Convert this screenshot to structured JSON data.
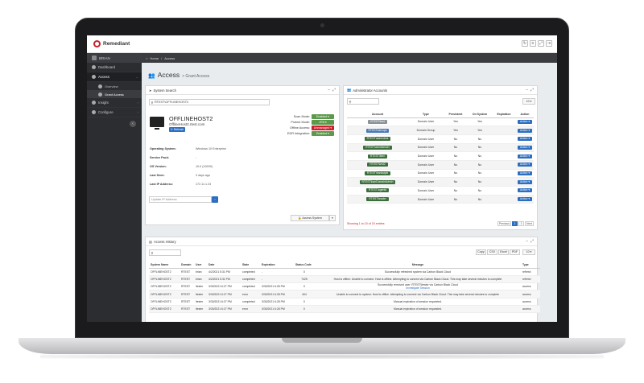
{
  "app": {
    "brand": "Remediant"
  },
  "colors": {
    "accent": "#2d6ec0",
    "danger": "#c8202c",
    "success": "#5b9a4a",
    "sidebar": "#2b2d31",
    "badge_dark": "#3c6e3c",
    "badge_grey": "#8a9399",
    "badge_blue": "#4a7ab5"
  },
  "topbar": {
    "icons": [
      "refresh-icon",
      "list-icon",
      "expand-icon",
      "logout-icon"
    ]
  },
  "sidebar": {
    "user": "BRIAN",
    "items": [
      {
        "label": "Dashboard"
      },
      {
        "label": "Access"
      },
      {
        "label": "Overview"
      },
      {
        "label": "Grant Access"
      },
      {
        "label": "Insight"
      },
      {
        "label": "Configure"
      }
    ]
  },
  "breadcrumb": {
    "home": "Home",
    "sep": "/",
    "current": "Access"
  },
  "page": {
    "title": "Access",
    "subtitle": "> Grant Access"
  },
  "system_search": {
    "title": "System Search",
    "search_value": "RTEST\\OFFLINEHOST2",
    "host_name": "OFFLINEHOST2",
    "host_fqdn": "OfflineHost2.rtest.com",
    "refresh_label": "Refresh",
    "modes": [
      {
        "label": "Scan Mode:",
        "value": "Enabled"
      },
      {
        "label": "Protect Mode:",
        "value": "JITA"
      },
      {
        "label": "Offline Access:",
        "value": "Unmanaged"
      },
      {
        "label": "EDR Integration:",
        "value": "Enabled"
      }
    ],
    "details": [
      {
        "label": "Operating System:",
        "value": "Windows 10 Enterprise"
      },
      {
        "label": "Service Pack:",
        "value": "-"
      },
      {
        "label": "OS Version:",
        "value": "10.0 (19209)"
      },
      {
        "label": "Last Seen:",
        "value": "3 days ago"
      },
      {
        "label": "Last IP Address:",
        "value": "172.11.1.23"
      }
    ],
    "ip_placeholder": "Update IP Address",
    "access_button": "Access System"
  },
  "admin_accounts": {
    "title": "Administrator Accounts",
    "page_size": "10",
    "headers": [
      "Account",
      "Type",
      "Persistent",
      "On System",
      "Expiration",
      "Action"
    ],
    "rows": [
      {
        "account": "RTEST\\test",
        "type": "Domain User",
        "persistent": "Yes",
        "on_system": "Yes",
        "expiration": "",
        "action": "Action",
        "badge": "grey"
      },
      {
        "account": "RTEST\\devops",
        "type": "Domain Group",
        "persistent": "Yes",
        "on_system": "Yes",
        "expiration": "",
        "action": "Action",
        "badge": "blue"
      },
      {
        "account": "RTEST\\admintest",
        "type": "Domain User",
        "persistent": "No",
        "on_system": "No",
        "expiration": "",
        "action": "Action",
        "badge": "dark"
      },
      {
        "account": "RTEST\\admintester",
        "type": "Domain User",
        "persistent": "No",
        "on_system": "No",
        "expiration": "",
        "action": "Action",
        "badge": "dark"
      },
      {
        "account": "RTEST\\bien",
        "type": "Domain User",
        "persistent": "No",
        "on_system": "No",
        "expiration": "",
        "action": "Action",
        "badge": "dark"
      },
      {
        "account": "RTEST\\test2",
        "type": "Domain User",
        "persistent": "No",
        "on_system": "No",
        "expiration": "",
        "action": "Action",
        "badge": "dark"
      },
      {
        "account": "RTEST\\frankstyle",
        "type": "Domain User",
        "persistent": "No",
        "on_system": "No",
        "expiration": "",
        "action": "Action",
        "badge": "dark"
      },
      {
        "account": "RTEST\\hanDomainAdmin",
        "type": "Domain User",
        "persistent": "No",
        "on_system": "No",
        "expiration": "",
        "action": "Action",
        "badge": "dark"
      },
      {
        "account": "RTEST\\agentd",
        "type": "Domain User",
        "persistent": "No",
        "on_system": "No",
        "expiration": "",
        "action": "Action",
        "badge": "dark"
      },
      {
        "account": "RTEST\\leader",
        "type": "Domain User",
        "persistent": "No",
        "on_system": "No",
        "expiration": "",
        "action": "Action",
        "badge": "dark"
      }
    ],
    "showing": "Showing 1 to 10 of 15 entries",
    "pagination": [
      "Previous",
      "1",
      "2",
      "Next"
    ]
  },
  "access_history": {
    "title": "Access History",
    "tools": [
      "Copy",
      "CSV",
      "Excel",
      "PDF"
    ],
    "page_size": "10",
    "headers": [
      "System Name",
      "Domain",
      "User",
      "Date",
      "State",
      "Expiration",
      "Status Code",
      "Message",
      "Type"
    ],
    "rows": [
      {
        "system": "OFFLINEHOST2",
        "domain": "RTEST",
        "user": "brian",
        "date": "4/2/2021 5:31 PM",
        "state": "completed",
        "expiration": "-",
        "code": "0",
        "message": "Successfully refreshed system via Carbon Black Cloud",
        "link": "",
        "type": "refresh"
      },
      {
        "system": "OFFLINEHOST2",
        "domain": "RTEST",
        "user": "brian",
        "date": "4/2/2021 5:31 PM",
        "state": "completed",
        "expiration": "-",
        "code": "7425",
        "message": "Host is offline: Unable to connect. Host is offline. Attempting to connect via Carbon Black Cloud. This may take several minutes to complete",
        "link": "",
        "type": "refresh"
      },
      {
        "system": "OFFLINEHOST2",
        "domain": "RTEST",
        "user": "ltester",
        "date": "3/30/2021 6:27 PM",
        "state": "completed",
        "expiration": "3/30/2021 6:28 PM",
        "code": "0",
        "message": "Successfully removed user: RTEST\\ltester via Carbon Black Cloud",
        "link": "Investigate Session",
        "type": "access"
      },
      {
        "system": "OFFLINEHOST2",
        "domain": "RTEST",
        "user": "ltester",
        "date": "3/30/2021 6:27 PM",
        "state": "error",
        "expiration": "3/30/2021 6:28 PM",
        "code": "404",
        "message": "Unable to connect to system: Host is offline. Attempting to connect via Carbon Black Cloud. This may take several minutes to complete",
        "link": "",
        "type": "access"
      },
      {
        "system": "OFFLINEHOST2",
        "domain": "RTEST",
        "user": "ltester",
        "date": "3/30/2021 6:27 PM",
        "state": "completed",
        "expiration": "3/30/2021 6:28 PM",
        "code": "0",
        "message": "Manual expiration of session requested.",
        "link": "",
        "type": "access"
      },
      {
        "system": "OFFLINEHOST2",
        "domain": "RTEST",
        "user": "ltester",
        "date": "3/30/2021 6:27 PM",
        "state": "error",
        "expiration": "3/30/2021 6:28 PM",
        "code": "0",
        "message": "Manual expiration of session requested.",
        "link": "",
        "type": "access"
      }
    ]
  }
}
